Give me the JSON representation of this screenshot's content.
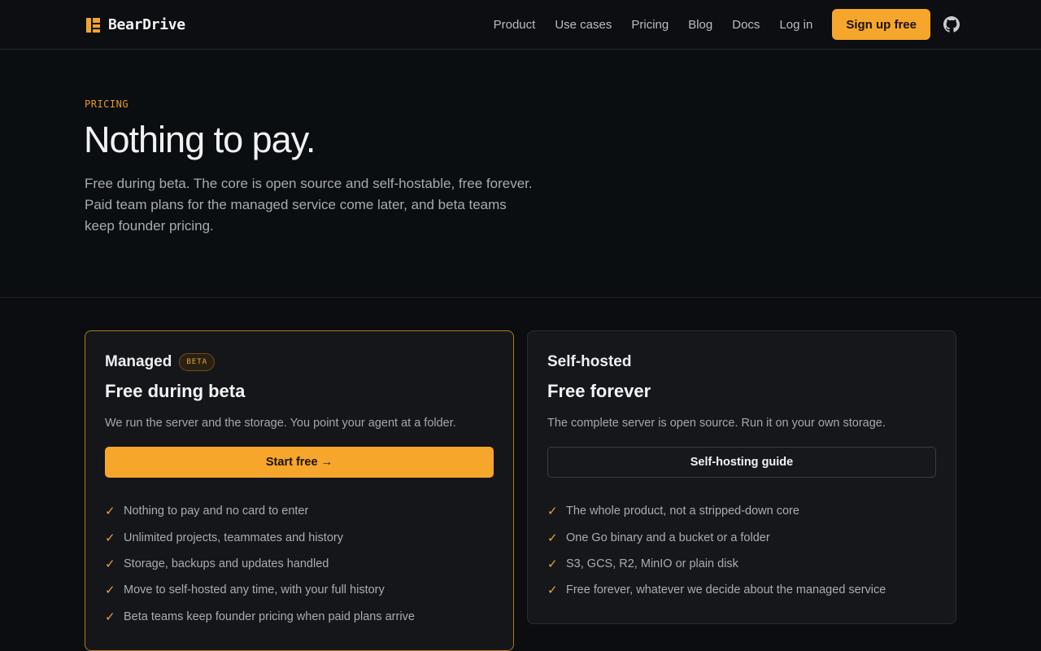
{
  "nav": {
    "brand": "BearDrive",
    "links": [
      "Product",
      "Use cases",
      "Pricing",
      "Blog",
      "Docs",
      "Log in"
    ],
    "signup": "Sign up free"
  },
  "hero": {
    "eyebrow": "PRICING",
    "title": "Nothing to pay.",
    "subtitle": "Free during beta. The core is open source and self-hostable, free forever. Paid team plans for the managed service come later, and beta teams keep founder pricing."
  },
  "plans": [
    {
      "name": "Managed",
      "badge": "BETA",
      "price": "Free during beta",
      "description": "We run the server and the storage. You point your agent at a folder.",
      "cta": "Start free →",
      "features": [
        "Nothing to pay and no card to enter",
        "Unlimited projects, teammates and history",
        "Storage, backups and updates handled",
        "Move to self-hosted any time, with your full history",
        "Beta teams keep founder pricing when paid plans arrive"
      ]
    },
    {
      "name": "Self-hosted",
      "price": "Free forever",
      "description": "The complete server is open source. Run it on your own storage.",
      "cta": "Self-hosting guide",
      "features": [
        "The whole product, not a stripped-down core",
        "One Go binary and a bucket or a folder",
        "S3, GCS, R2, MinIO or plain disk",
        "Free forever, whatever we decide about the managed service"
      ]
    }
  ],
  "colors": {
    "accent": "#f5a62b",
    "background": "#0b0d10",
    "card": "#15171b"
  },
  "icons": {
    "brand": "beardrive-logo-icon",
    "github": "github-icon",
    "check": "check-icon"
  }
}
